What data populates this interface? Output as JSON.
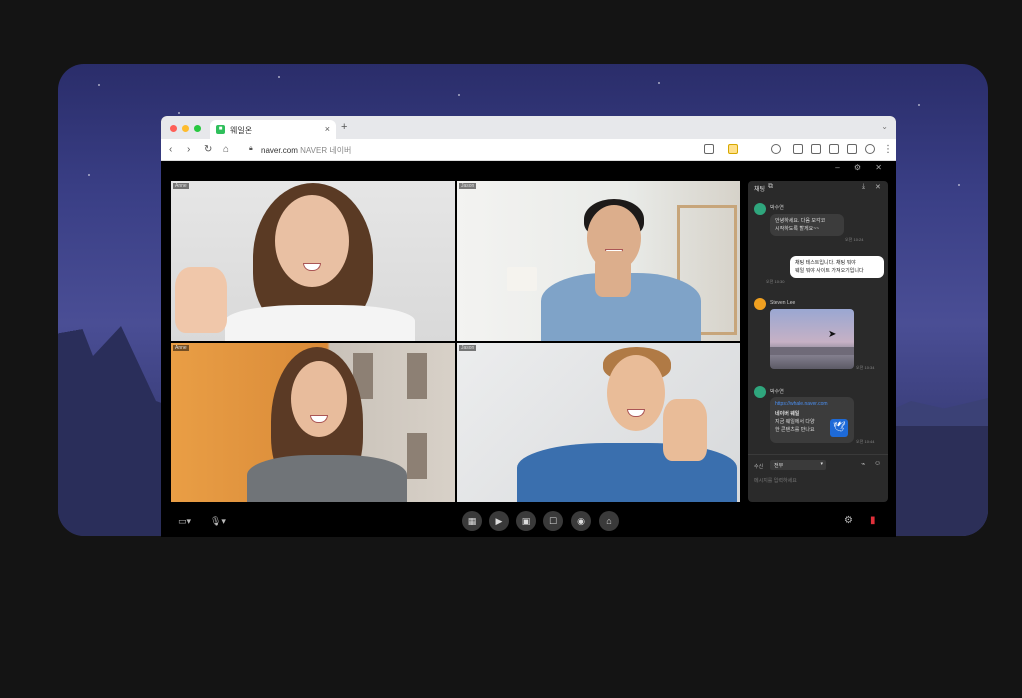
{
  "browser": {
    "tab_title": "웨일온",
    "tab_close": "×",
    "new_tab": "+",
    "url_domain": "naver.com",
    "url_site": "NAVER 네이버"
  },
  "video": {
    "tile_labels": [
      "Anne",
      "Jason",
      "Anne",
      "Jason"
    ]
  },
  "chat": {
    "title": "채팅",
    "messages": [
      {
        "sender": "박수연",
        "text_line1": "안녕하세요. 다음 모각코",
        "text_line2": "시작하도록 할게요~~",
        "time": "오전 10:24"
      },
      {
        "text_line1": "채팅 테스트입니다. 채팅 뭐야",
        "text_line2": "웨일 뭐야 사이트 가져오기입니다",
        "time": "오전 10:30"
      },
      {
        "sender": "Steven Lee",
        "time": "오전 10:34"
      },
      {
        "sender": "박수연",
        "link": "https://whale.naver.com",
        "card_title": "네이버 웨일",
        "card_line1": "지금 웨일에서 다양",
        "card_line2": "한 콘텐츠를 만나요",
        "time": "오전 10:44"
      }
    ],
    "receiver_label": "수신",
    "receiver_value": "전무",
    "input_placeholder": "메시지를 입력하세요"
  },
  "colors": {
    "accent_green": "#2fbf5b",
    "exit_red": "#e0303a",
    "avatar_green": "#2fa67d",
    "avatar_orange": "#f0a020"
  },
  "icons": [
    "camera-icon",
    "mic-icon",
    "grid-icon",
    "play-icon",
    "screen-share-icon",
    "chat-icon",
    "person-icon",
    "home-icon",
    "settings-icon",
    "exit-icon"
  ]
}
